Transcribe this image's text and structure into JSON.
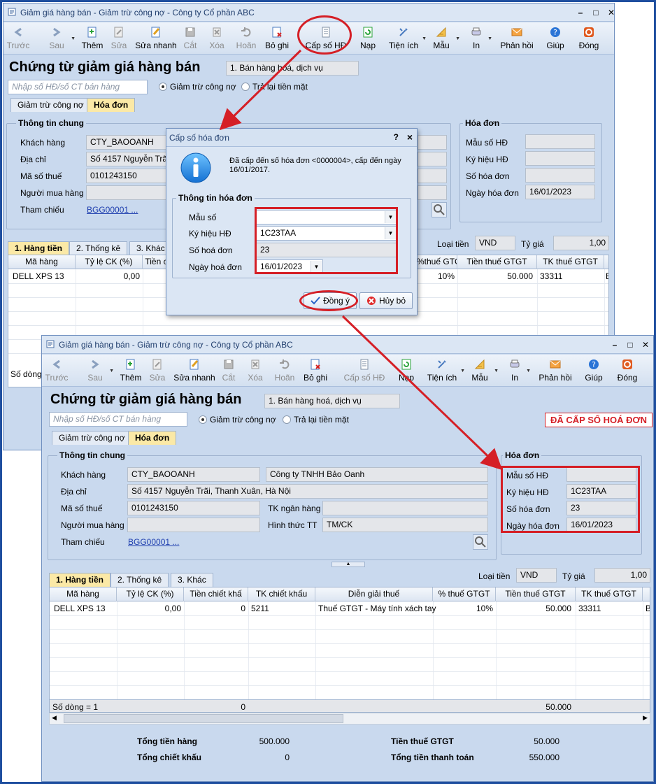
{
  "colors": {
    "annotation": "#d51f26",
    "titlebar": "#dbe6f4",
    "window_bg": "#c9d9ee",
    "active_tab": "#fbe9a6"
  },
  "back_window": {
    "title": "Giảm giá hàng bán - Giảm trừ công nợ - Công ty Cổ phần ABC",
    "toolbar": [
      "Trước",
      "Sau",
      "Thêm",
      "Sửa",
      "Sửa nhanh",
      "Cắt",
      "Xóa",
      "Hoãn",
      "Bỏ ghi",
      "Cấp số HĐ",
      "Nạp",
      "Tiện ích",
      "Mẫu",
      "In",
      "Phản hồi",
      "Giúp",
      "Đóng"
    ],
    "heading": "Chứng từ giảm giá hàng bán",
    "type_value": "1. Bán hàng hoá, dịch vụ",
    "search_placeholder": "Nhập số HĐ/số CT bán hàng",
    "radio1": "Giảm trừ công nợ",
    "radio2": "Trả lại tiền mặt",
    "tab1": "Giảm trừ công nợ",
    "tab2": "Hóa đơn",
    "group_general": "Thông tin chung",
    "lbl_customer": "Khách hàng",
    "val_customer": "CTY_BAOOANH",
    "lbl_address": "Địa chỉ",
    "val_address": "Số 4157 Nguyễn Trãi,",
    "lbl_taxcode": "Mã số thuế",
    "val_taxcode": "0101243150",
    "lbl_buyer": "Người mua hàng",
    "lbl_ref": "Tham chiếu",
    "val_ref": "BGG00001 ...",
    "group_invoice": "Hóa đơn",
    "lbl_form": "Mẫu số HĐ",
    "lbl_symbol": "Ký hiệu HĐ",
    "lbl_number": "Số hóa đơn",
    "lbl_date": "Ngày hóa đơn",
    "val_date": "16/01/2023",
    "subtab1": "1. Hàng tiền",
    "subtab2": "2. Thống kê",
    "subtab3": "3. Khác",
    "lbl_currency": "Loại tiền",
    "val_currency": "VND",
    "lbl_rate": "Tỷ giá",
    "val_rate": "1,00",
    "grid_headers": [
      "Mã hàng",
      "Tỷ lệ CK (%)",
      "Tiền c",
      "%thuế GTGT",
      "Tiền thuế GTGT",
      "TK thuế GTGT"
    ],
    "row": {
      "item": "DELL XPS 13",
      "ck": "0,00",
      "vat": "10%",
      "vat_amount": "50.000",
      "vat_account": "33311",
      "extra": "B"
    },
    "status_count": "Số dòng ="
  },
  "dialog": {
    "title": "Cấp số hóa đơn",
    "help": "?",
    "close": "×",
    "message": "Đã cấp đến số hóa đơn <0000004>, cấp đến ngày 16/01/2017.",
    "group": "Thông tin hóa đơn",
    "lbl_form": "Mẫu số",
    "lbl_symbol": "Ký hiệu HĐ",
    "val_symbol": "1C23TAA",
    "lbl_number": "Số hoá đơn",
    "val_number": "23",
    "lbl_date": "Ngày hoá đơn",
    "val_date": "16/01/2023",
    "ok": "Đồng ý",
    "cancel": "Hủy bỏ"
  },
  "front_window": {
    "title": "Giảm giá hàng bán - Giảm trừ công nợ - Công ty Cổ phần ABC",
    "toolbar": [
      "Trước",
      "Sau",
      "Thêm",
      "Sửa",
      "Sửa nhanh",
      "Cắt",
      "Xóa",
      "Hoãn",
      "Bỏ ghi",
      "Cấp số HĐ",
      "Nạp",
      "Tiện ích",
      "Mẫu",
      "In",
      "Phản hồi",
      "Giúp",
      "Đóng"
    ],
    "heading": "Chứng từ giảm giá hàng bán",
    "type_value": "1. Bán hàng hoá, dịch vụ",
    "search_placeholder": "Nhập số HĐ/số CT bán hàng",
    "radio1": "Giảm trừ công nợ",
    "radio2": "Trả lại tiền mặt",
    "note": "ĐÃ CẤP SỐ HOÁ ĐƠN",
    "tab1": "Giảm trừ công nợ",
    "tab2": "Hóa đơn",
    "group_general": "Thông tin chung",
    "lbl_customer": "Khách hàng",
    "val_customer": "CTY_BAOOANH",
    "val_customer_name": "Công ty TNHH Bảo Oanh",
    "lbl_address": "Địa chỉ",
    "val_address": "Số 4157 Nguyễn Trãi, Thanh Xuân, Hà Nội",
    "lbl_taxcode": "Mã số thuế",
    "val_taxcode": "0101243150",
    "lbl_bank": "TK ngân hàng",
    "lbl_buyer": "Người mua hàng",
    "lbl_payment": "Hình thức TT",
    "val_payment": "TM/CK",
    "lbl_ref": "Tham chiếu",
    "val_ref": "BGG00001 ...",
    "group_invoice": "Hóa đơn",
    "lbl_form": "Mẫu số HĐ",
    "lbl_symbol": "Ký hiệu HĐ",
    "val_symbol": "1C23TAA",
    "lbl_number": "Số hóa đơn",
    "val_number": "23",
    "lbl_date": "Ngày hóa đơn",
    "val_date": "16/01/2023",
    "subtab1": "1. Hàng tiền",
    "subtab2": "2. Thống kê",
    "subtab3": "3. Khác",
    "lbl_currency": "Loại tiền",
    "val_currency": "VND",
    "lbl_rate": "Tỷ giá",
    "val_rate": "1,00",
    "grid_headers": [
      "Mã hàng",
      "Tỷ lệ CK (%)",
      "Tiền chiết khấ",
      "TK chiết khấu",
      "Diễn giải thuế",
      "% thuế GTGT",
      "Tiền thuế GTGT",
      "TK thuế GTGT"
    ],
    "row": {
      "item": "DELL XPS 13",
      "ck": "0,00",
      "discount": "0",
      "discount_account": "5211",
      "desc": "Thuế GTGT - Máy tính xách tay",
      "vat": "10%",
      "vat_amount": "50.000",
      "vat_account": "33311",
      "extra": "B"
    },
    "footer": {
      "count": "Số dòng = 1",
      "discount_total": "0",
      "vat_total": "50.000"
    },
    "summary": {
      "lbl_goods": "Tổng tiền hàng",
      "val_goods": "500.000",
      "lbl_discount": "Tổng chiết khấu",
      "val_discount": "0",
      "lbl_vat": "Tiền thuế GTGT",
      "val_vat": "50.000",
      "lbl_total": "Tổng tiền thanh toán",
      "val_total": "550.000"
    }
  }
}
